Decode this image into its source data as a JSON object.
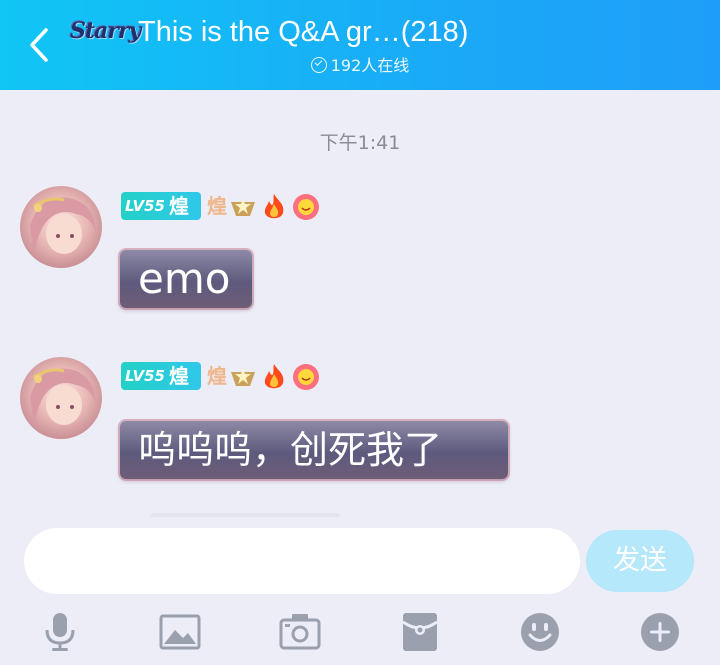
{
  "header": {
    "group_badge": "Starry",
    "title": "This is the Q&A gr…(218)",
    "online_status": "192人在线"
  },
  "chat": {
    "timestamp": "下午1:41",
    "messages": [
      {
        "level_label": "LV55",
        "rank_label": "煌",
        "rank_label_2": "煌",
        "text": "emo"
      },
      {
        "level_label": "LV55",
        "rank_label": "煌",
        "rank_label_2": "煌",
        "text": "呜呜呜，创死我了"
      }
    ]
  },
  "composer": {
    "input_value": "",
    "send_label": "发送"
  },
  "toolbar": {
    "icons": [
      "microphone-icon",
      "image-icon",
      "camera-icon",
      "red-packet-icon",
      "emoji-icon",
      "plus-icon"
    ]
  },
  "colors": {
    "header_gradient_start": "#10c6f5",
    "header_gradient_end": "#1e9ef8",
    "background": "#ecedf6",
    "send_button": "#b5e8fb",
    "toolbar_icon": "#9aa0ad"
  }
}
